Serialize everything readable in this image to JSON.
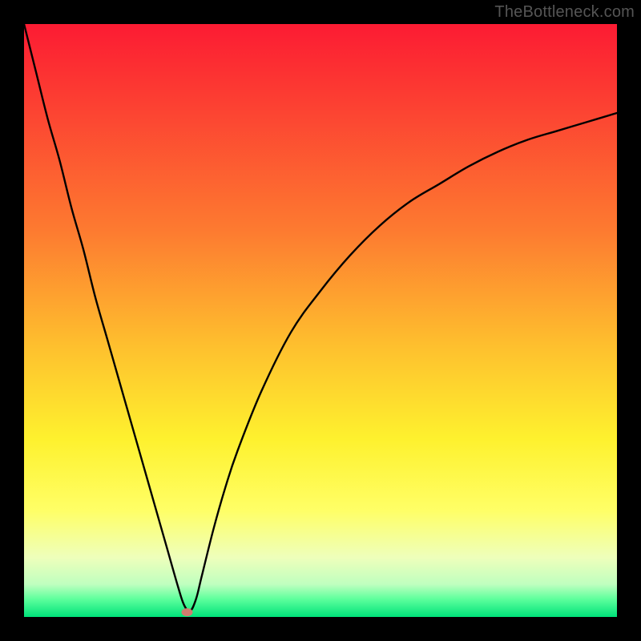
{
  "watermark": "TheBottleneck.com",
  "chart_data": {
    "type": "line",
    "title": "",
    "xlabel": "",
    "ylabel": "",
    "xlim": [
      0,
      100
    ],
    "ylim": [
      0,
      100
    ],
    "series": [
      {
        "name": "bottleneck-curve",
        "x": [
          0,
          2,
          4,
          6,
          8,
          10,
          12,
          14,
          16,
          18,
          20,
          22,
          24,
          26,
          27,
          28,
          29,
          30,
          32,
          34,
          36,
          40,
          45,
          50,
          55,
          60,
          65,
          70,
          75,
          80,
          85,
          90,
          95,
          100
        ],
        "y": [
          100,
          92,
          84,
          77,
          69,
          62,
          54,
          47,
          40,
          33,
          26,
          19,
          12,
          5,
          2,
          1,
          3,
          7,
          15,
          22,
          28,
          38,
          48,
          55,
          61,
          66,
          70,
          73,
          76,
          78.5,
          80.5,
          82,
          83.5,
          85
        ]
      }
    ],
    "marker": {
      "x": 27.5,
      "y": 0.8
    },
    "green_band": {
      "y_start": 0,
      "y_end": 5
    },
    "background_gradient": {
      "stops": [
        {
          "offset": 0.0,
          "color": "#fc1b33"
        },
        {
          "offset": 0.35,
          "color": "#fd7b30"
        },
        {
          "offset": 0.55,
          "color": "#fec22e"
        },
        {
          "offset": 0.7,
          "color": "#fef12e"
        },
        {
          "offset": 0.82,
          "color": "#ffff66"
        },
        {
          "offset": 0.9,
          "color": "#eeffbb"
        },
        {
          "offset": 0.945,
          "color": "#bfffbf"
        },
        {
          "offset": 0.97,
          "color": "#5dff9c"
        },
        {
          "offset": 1.0,
          "color": "#00e27a"
        }
      ]
    }
  }
}
